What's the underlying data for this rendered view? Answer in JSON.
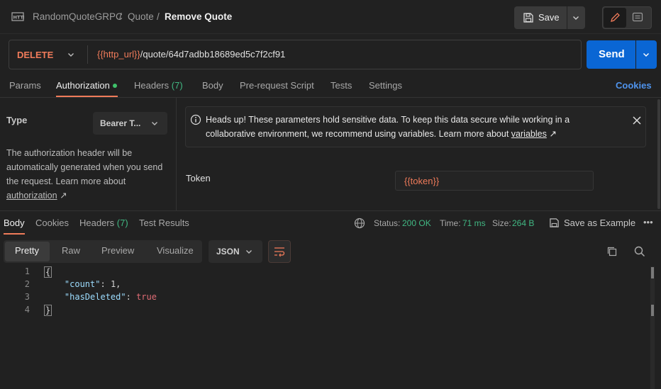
{
  "breadcrumb": {
    "collection": "RandomQuoteGRPC",
    "folder": "Quote",
    "request": "Remove Quote",
    "sep": "/"
  },
  "toolbar": {
    "save_label": "Save"
  },
  "request": {
    "method": "DELETE",
    "url_var": "{{http_url}}",
    "url_path": "/quote/64d7adbb18689ed5c7f2cf91",
    "send_label": "Send"
  },
  "tabs": [
    {
      "label": "Params",
      "count": ""
    },
    {
      "label": "Authorization",
      "count": ""
    },
    {
      "label": "Headers",
      "count": "(7)"
    },
    {
      "label": "Body",
      "count": ""
    },
    {
      "label": "Pre-request Script",
      "count": ""
    },
    {
      "label": "Tests",
      "count": ""
    },
    {
      "label": "Settings",
      "count": ""
    }
  ],
  "cookies_label": "Cookies",
  "auth": {
    "type_label": "Type",
    "type_value": "Bearer T...",
    "desc_text": "The authorization header will be automatically generated when you send the request. Learn more about",
    "desc_link": "authorization",
    "alert_text": "Heads up! These parameters hold sensitive data. To keep this data secure while working in a collaborative environment, we recommend using variables. Learn more about",
    "alert_link": "variables",
    "token_label": "Token",
    "token_value": "{{token}}"
  },
  "response": {
    "tabs": [
      {
        "label": "Body",
        "count": ""
      },
      {
        "label": "Cookies",
        "count": ""
      },
      {
        "label": "Headers",
        "count": "(7)"
      },
      {
        "label": "Test Results",
        "count": ""
      }
    ],
    "status_label": "Status:",
    "status_value": "200 OK",
    "time_label": "Time:",
    "time_value": "71 ms",
    "size_label": "Size:",
    "size_value": "264 B",
    "save_example": "Save as Example",
    "views": [
      "Pretty",
      "Raw",
      "Preview",
      "Visualize"
    ],
    "format": "JSON",
    "code": [
      {
        "num": "1",
        "text": "{"
      },
      {
        "num": "2",
        "key": "\"count\"",
        "value": "1"
      },
      {
        "num": "3",
        "key": "\"hasDeleted\"",
        "value": "true"
      },
      {
        "num": "4",
        "text": "}"
      }
    ]
  },
  "colors": {
    "accent": "#f07b5a",
    "send": "#0a66d4",
    "success": "#41b883",
    "link": "#4f94ee"
  },
  "icons": [
    "http-icon",
    "save-icon",
    "chevron-down-icon",
    "edit-icon",
    "comment-icon",
    "info-icon",
    "close-icon",
    "globe-icon",
    "more-icon",
    "copy-icon",
    "search-icon",
    "wrap-icon"
  ]
}
